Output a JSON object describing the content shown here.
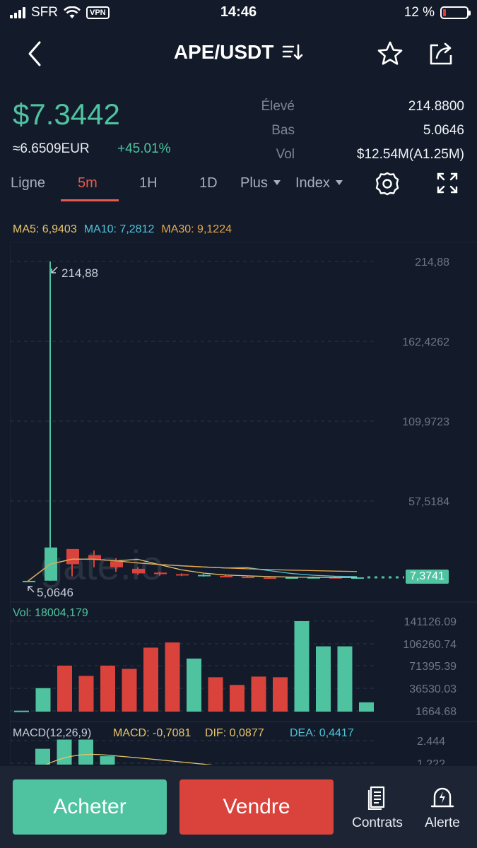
{
  "status_bar": {
    "carrier": "SFR",
    "vpn": "VPN",
    "time": "14:46",
    "battery": "12 %"
  },
  "header": {
    "pair": "APE/USDT"
  },
  "ticker": {
    "last_price": "$7.3442",
    "eur_equiv": "≈6.6509EUR",
    "change": "+45.01%",
    "high_label": "Élevé",
    "high_value": "214.8800",
    "low_label": "Bas",
    "low_value": "5.0646",
    "vol_label": "Vol",
    "vol_value": "$12.54M(A1.25M)"
  },
  "tabs": {
    "line": "Ligne",
    "m5": "5m",
    "h1": "1H",
    "d1": "1D",
    "more": "Plus",
    "index": "Index"
  },
  "ma_legend": {
    "ma5": "MA5: 6,9403",
    "ma10": "MA10: 7,2812",
    "ma30": "MA30: 9,1224"
  },
  "chart_data": {
    "type": "candlestick",
    "watermark": "gate.io",
    "price_axis_labels": [
      "214,88",
      "162,4262",
      "109,9723",
      "57,5184"
    ],
    "high_marker": "214,88",
    "low_marker": "5,0646",
    "last_price_tag": "7,3741",
    "candles": [
      {
        "o": 5.07,
        "h": 5.2,
        "l": 5.0646,
        "c": 5.1,
        "dir": "up"
      },
      {
        "o": 5.2,
        "h": 214.88,
        "l": 5.1,
        "c": 27.0,
        "dir": "up"
      },
      {
        "o": 16.0,
        "h": 24.0,
        "l": 8.0,
        "c": 26.0,
        "dir": "down"
      },
      {
        "o": 22.0,
        "h": 25.0,
        "l": 14.0,
        "c": 19.0,
        "dir": "down"
      },
      {
        "o": 18.0,
        "h": 20.0,
        "l": 11.0,
        "c": 14.0,
        "dir": "down"
      },
      {
        "o": 13.0,
        "h": 14.0,
        "l": 9.0,
        "c": 10.0,
        "dir": "down"
      },
      {
        "o": 10.5,
        "h": 11.0,
        "l": 8.5,
        "c": 9.5,
        "dir": "down"
      },
      {
        "o": 9.5,
        "h": 10.0,
        "l": 8.2,
        "c": 9.0,
        "dir": "down"
      },
      {
        "o": 9.0,
        "h": 9.5,
        "l": 7.9,
        "c": 8.3,
        "dir": "up"
      },
      {
        "o": 8.3,
        "h": 9.0,
        "l": 7.4,
        "c": 7.8,
        "dir": "down"
      },
      {
        "o": 7.8,
        "h": 8.5,
        "l": 7.0,
        "c": 7.3,
        "dir": "down"
      },
      {
        "o": 7.3,
        "h": 8.0,
        "l": 6.9,
        "c": 7.0,
        "dir": "down"
      },
      {
        "o": 7.0,
        "h": 7.6,
        "l": 6.7,
        "c": 7.4,
        "dir": "up"
      },
      {
        "o": 7.4,
        "h": 7.8,
        "l": 6.9,
        "c": 7.5,
        "dir": "up"
      },
      {
        "o": 7.5,
        "h": 7.8,
        "l": 7.0,
        "c": 7.3,
        "dir": "down"
      },
      {
        "o": 7.3,
        "h": 7.6,
        "l": 7.0,
        "c": 7.37,
        "dir": "up"
      }
    ],
    "volume_label": "Vol: 18004,179",
    "volume_axis_labels": [
      "141126.09",
      "106260.74",
      "71395.39",
      "36530.03",
      "1664.68"
    ],
    "volume_bars": [
      {
        "v": 2000,
        "dir": "up"
      },
      {
        "v": 37000,
        "dir": "up"
      },
      {
        "v": 72000,
        "dir": "down"
      },
      {
        "v": 56000,
        "dir": "down"
      },
      {
        "v": 72000,
        "dir": "down"
      },
      {
        "v": 67000,
        "dir": "down"
      },
      {
        "v": 100000,
        "dir": "down"
      },
      {
        "v": 108000,
        "dir": "down"
      },
      {
        "v": 83000,
        "dir": "up"
      },
      {
        "v": 54000,
        "dir": "down"
      },
      {
        "v": 42000,
        "dir": "down"
      },
      {
        "v": 55000,
        "dir": "down"
      },
      {
        "v": 54000,
        "dir": "down"
      },
      {
        "v": 141126,
        "dir": "up"
      },
      {
        "v": 102000,
        "dir": "up"
      },
      {
        "v": 102000,
        "dir": "up"
      },
      {
        "v": 15000,
        "dir": "up"
      }
    ],
    "macd_legend": {
      "name": "MACD(12,26,9)",
      "macd": "MACD: -0,7081",
      "dif": "DIF: 0,0877",
      "dea": "DEA: 0,4417"
    },
    "macd_axis_labels": [
      "2.444",
      "1.222"
    ],
    "macd_bars": [
      2.0,
      2.5,
      2.5,
      1.6
    ]
  },
  "bottom": {
    "buy": "Acheter",
    "sell": "Vendre",
    "contracts": "Contrats",
    "alert": "Alerte"
  },
  "colors": {
    "up": "#4fc3a0",
    "down": "#d9433b",
    "background": "#131b2a"
  }
}
